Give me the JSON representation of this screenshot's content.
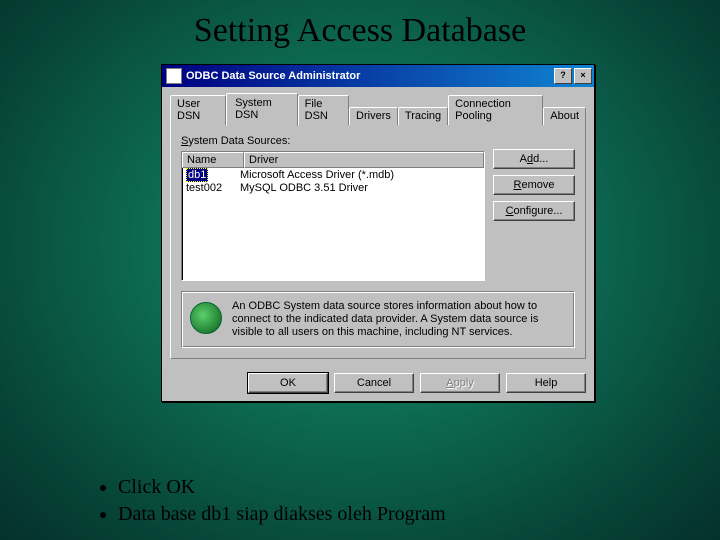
{
  "slide": {
    "title": "Setting Access Database",
    "bullets": [
      "Click OK",
      "Data base db1 siap diakses oleh Program"
    ]
  },
  "dialog": {
    "title": "ODBC Data Source Administrator",
    "help_btn": "?",
    "close_btn": "×",
    "tabs": {
      "user_dsn": "User DSN",
      "system_dsn": "System DSN",
      "file_dsn": "File DSN",
      "drivers": "Drivers",
      "tracing": "Tracing",
      "pooling": "Connection Pooling",
      "about": "About"
    },
    "panel": {
      "label": "System Data Sources:",
      "col_name": "Name",
      "col_driver": "Driver",
      "rows": [
        {
          "name": "db1",
          "driver": "Microsoft Access Driver (*.mdb)"
        },
        {
          "name": "test002",
          "driver": "MySQL ODBC 3.51 Driver"
        }
      ],
      "buttons": {
        "add": "Add...",
        "remove": "Remove",
        "configure": "Configure..."
      },
      "info": "An ODBC System data source stores information about how to connect to the indicated data provider.  A System data source is visible to all users on this machine, including NT services."
    },
    "bottom": {
      "ok": "OK",
      "cancel": "Cancel",
      "apply": "Apply",
      "help": "Help"
    }
  }
}
